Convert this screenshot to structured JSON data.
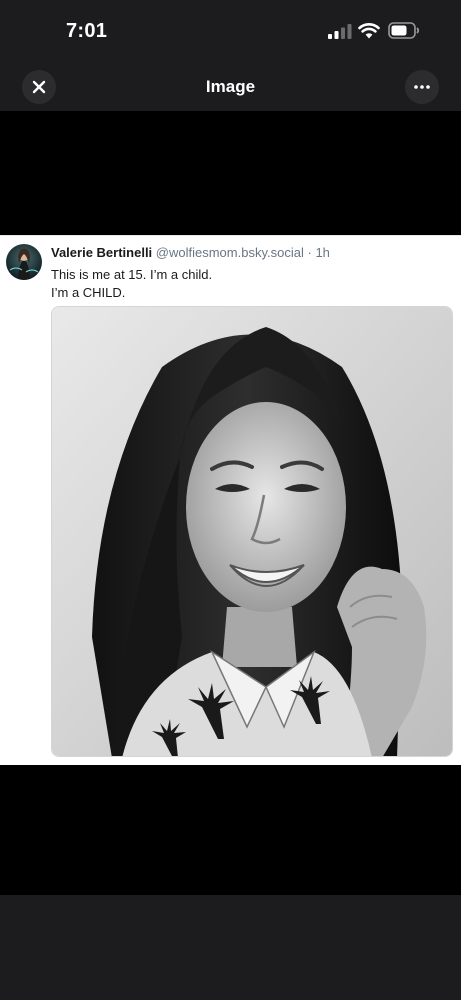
{
  "status_bar": {
    "time": "7:01",
    "signal_icon": "cellular-signal-icon",
    "wifi_icon": "wifi-icon",
    "battery_icon": "battery-icon"
  },
  "nav": {
    "title": "Image",
    "close_icon": "close-icon",
    "more_icon": "more-horizontal-icon"
  },
  "post": {
    "display_name": "Valerie Bertinelli",
    "handle": "@wolfiesmom.bsky.social",
    "separator": "·",
    "timestamp": "1h",
    "text_line_1": "This is me at 15. I’m a child.",
    "text_line_2": "I’m a CHILD.",
    "avatar": "profile-avatar-photo",
    "photo": "black-and-white-school-portrait-photo"
  },
  "colors": {
    "chrome_background": "#1c1c1e",
    "viewer_background": "#000000",
    "card_background": "#ffffff",
    "handle_gray": "#687684",
    "button_background": "#2c2c2e"
  }
}
